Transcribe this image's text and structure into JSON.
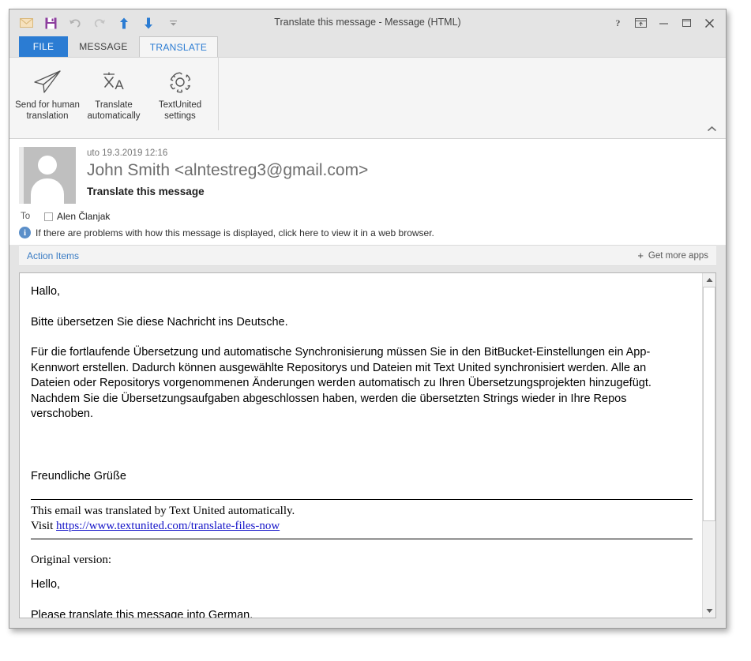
{
  "window": {
    "title": "Translate this message - Message (HTML)",
    "quick_access": [
      {
        "name": "envelope-icon",
        "label": "New Message"
      },
      {
        "name": "save-icon",
        "label": "Save"
      },
      {
        "name": "undo-icon",
        "label": "Undo"
      },
      {
        "name": "redo-icon",
        "label": "Redo"
      },
      {
        "name": "previous-item-icon",
        "label": "Previous Item"
      },
      {
        "name": "next-item-icon",
        "label": "Next Item"
      },
      {
        "name": "customize-quick-access-icon",
        "label": "Customize Quick Access Toolbar"
      }
    ],
    "controls": [
      {
        "name": "help-button",
        "glyph": "?"
      },
      {
        "name": "ribbon-display-options-button",
        "glyph": "ribbon"
      },
      {
        "name": "minimize-button",
        "glyph": "minimize"
      },
      {
        "name": "maximize-button",
        "glyph": "maximize"
      },
      {
        "name": "close-button",
        "glyph": "close"
      }
    ]
  },
  "tabs": [
    {
      "label": "FILE",
      "active": false,
      "kind": "file"
    },
    {
      "label": "MESSAGE",
      "active": false,
      "kind": "normal"
    },
    {
      "label": "TRANSLATE",
      "active": true,
      "kind": "normal"
    }
  ],
  "ribbon": {
    "buttons": [
      {
        "icon": "send-plane-icon",
        "line1": "Send for human",
        "line2": "translation"
      },
      {
        "icon": "translate-icon",
        "line1": "Translate",
        "line2": "automatically"
      },
      {
        "icon": "gear-icon",
        "line1": "TextUnited",
        "line2": "settings"
      }
    ],
    "collapse_label": "Collapse the Ribbon"
  },
  "message": {
    "date": "uto 19.3.2019 12:16",
    "from": "John Smith <alntestreg3@gmail.com>",
    "subject": "Translate this message",
    "to_label": "To",
    "to_recipient": "Alen Članjak",
    "info_bar": "If there are problems with how this message is displayed, click here to view it in a web browser.",
    "info_icon_glyph": "i"
  },
  "appbar": {
    "action_items_label": "Action Items",
    "get_more_apps_label": "Get more apps",
    "plus_glyph": "+"
  },
  "body": {
    "greeting": "Hallo,",
    "request": "Bitte übersetzen Sie diese Nachricht ins Deutsche.",
    "paragraph": "Für die fortlaufende Übersetzung und automatische Synchronisierung müssen Sie in den BitBucket-Einstellungen ein App-Kennwort erstellen. Dadurch können ausgewählte Repositorys und Dateien mit Text United synchronisiert werden. Alle an Dateien oder Repositorys vorgenommenen Änderungen werden automatisch zu Ihren Übersetzungsprojekten hinzugefügt. Nachdem Sie die Übersetzungsaufgaben abgeschlossen haben, werden die übersetzten Strings wieder in Ihre Repos verschoben.",
    "closing": "Freundliche Grüße",
    "footer_line1": "This email was translated by Text United automatically.",
    "footer_visit_prefix": "Visit ",
    "footer_link": "https://www.textunited.com/translate-files-now",
    "original_label": "Original version:",
    "original_greeting": "Hello,",
    "original_request": "Please translate this message into German."
  },
  "scrollbar": {
    "up_glyph": "▲",
    "down_glyph": "▼"
  },
  "colors": {
    "accent_blue": "#2b7cd3",
    "link_blue": "#3a7cc4",
    "hyperlink_blue": "#1414c8",
    "window_chrome": "#e4e4e4",
    "ribbon_bg": "#f5f5f5"
  }
}
